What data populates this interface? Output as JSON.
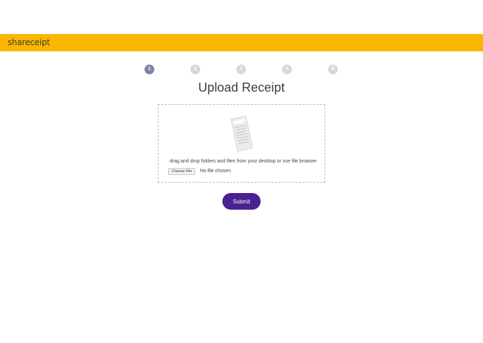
{
  "navbar": {
    "brand": "shareceipt",
    "color": "#fbb700"
  },
  "steps": [
    {
      "label": "1",
      "active": true
    },
    {
      "label": "2",
      "active": false
    },
    {
      "label": "3",
      "active": false
    },
    {
      "label": "4",
      "active": false
    },
    {
      "label": "5",
      "active": false
    }
  ],
  "page": {
    "title": "Upload Receipt"
  },
  "upload": {
    "icon": "receipt-icon",
    "hint": "drag and drop folders and files from your desktop or use file browser",
    "choose_label": "Choose File",
    "file_status": "No file chosen"
  },
  "actions": {
    "submit_label": "Submit",
    "submit_color": "#4b2190"
  }
}
